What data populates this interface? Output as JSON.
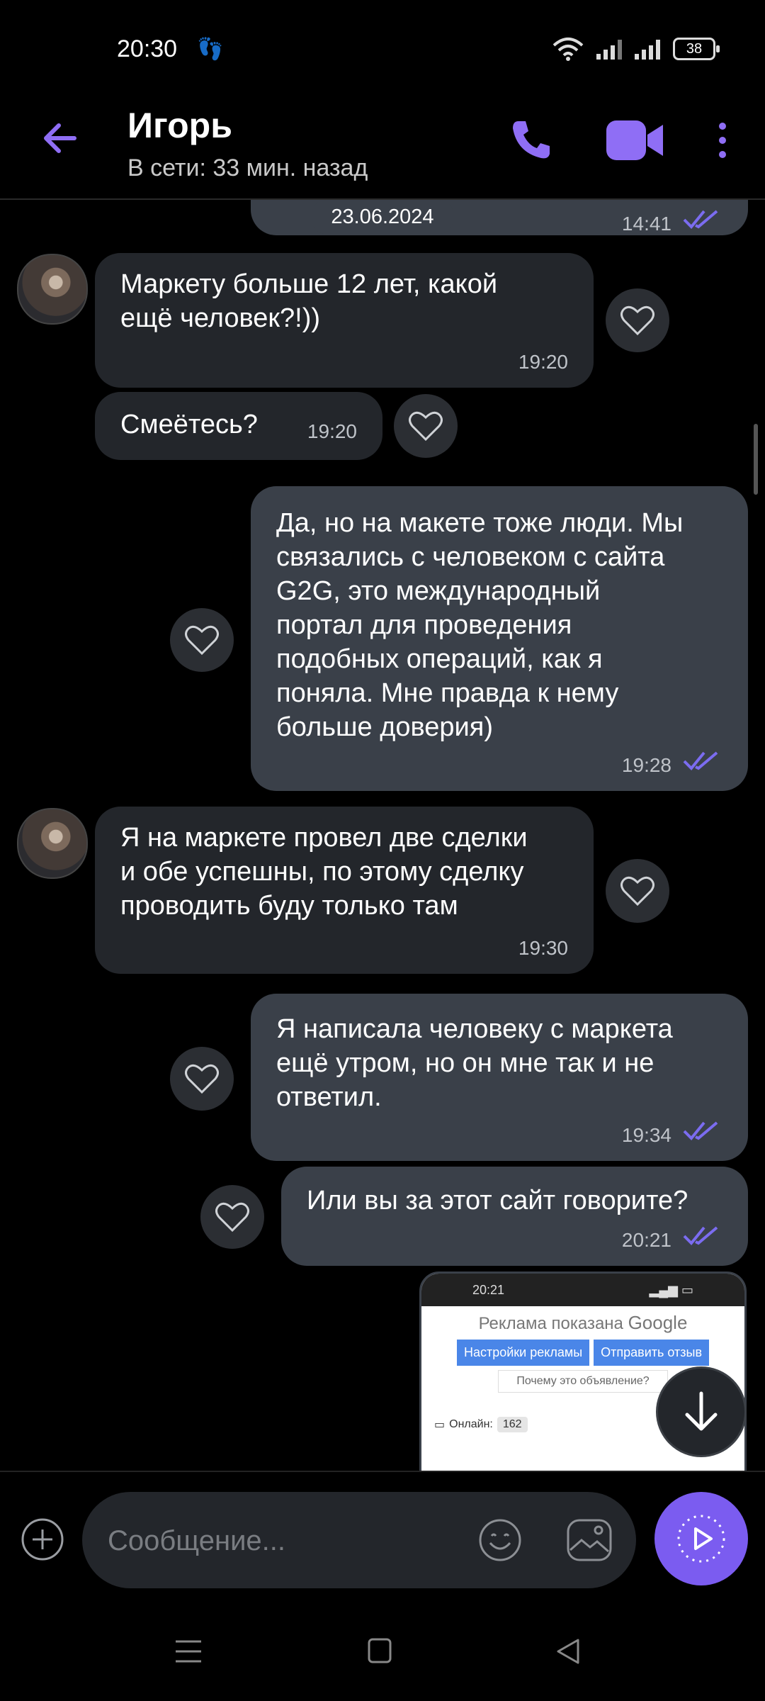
{
  "status_bar": {
    "time": "20:30",
    "battery": "38"
  },
  "header": {
    "contact_name": "Игорь",
    "contact_status": "В сети: 33 мин. назад"
  },
  "chat": {
    "date_divider": "23.06.2024",
    "top_partial_time": "14:41",
    "messages": [
      {
        "direction": "in",
        "text": "Маркету больше 12 лет, какой\nещё человек?!))",
        "time": "19:20"
      },
      {
        "direction": "in",
        "text": "Смеётесь?",
        "time": "19:20"
      },
      {
        "direction": "out",
        "text": "Да, но на макете тоже люди. Мы\nсвязались с человеком с сайта\nG2G, это международный\nпортал для проведения\nподобных операций, как я\nпоняла. Мне правда к нему\nбольше доверия)",
        "time": "19:28"
      },
      {
        "direction": "in",
        "text": "Я на маркете провел две сделки\nи обе успешны, по этому сделку\nпроводить буду только там",
        "time": "19:30"
      },
      {
        "direction": "out",
        "text": "Я написала человеку с маркета\nещё утром, но он мне так и не\nответил.",
        "time": "19:34"
      },
      {
        "direction": "out",
        "text": "Или вы за этот сайт говорите?",
        "time": "20:21"
      }
    ],
    "image_preview": {
      "time": "20:21",
      "ad_label": "Реклама показана",
      "ad_brand": "Google",
      "button_settings": "Настройки рекламы",
      "button_feedback": "Отправить отзыв",
      "why_label": "Почему это объявление?",
      "online_label": "Онлайн:",
      "online_count": "162"
    }
  },
  "composer": {
    "placeholder": "Сообщение..."
  },
  "colors": {
    "accent": "#7b5cf0",
    "incoming": "#23262b",
    "outgoing": "#3a4049",
    "read_ticks": "#7b6cf0"
  }
}
